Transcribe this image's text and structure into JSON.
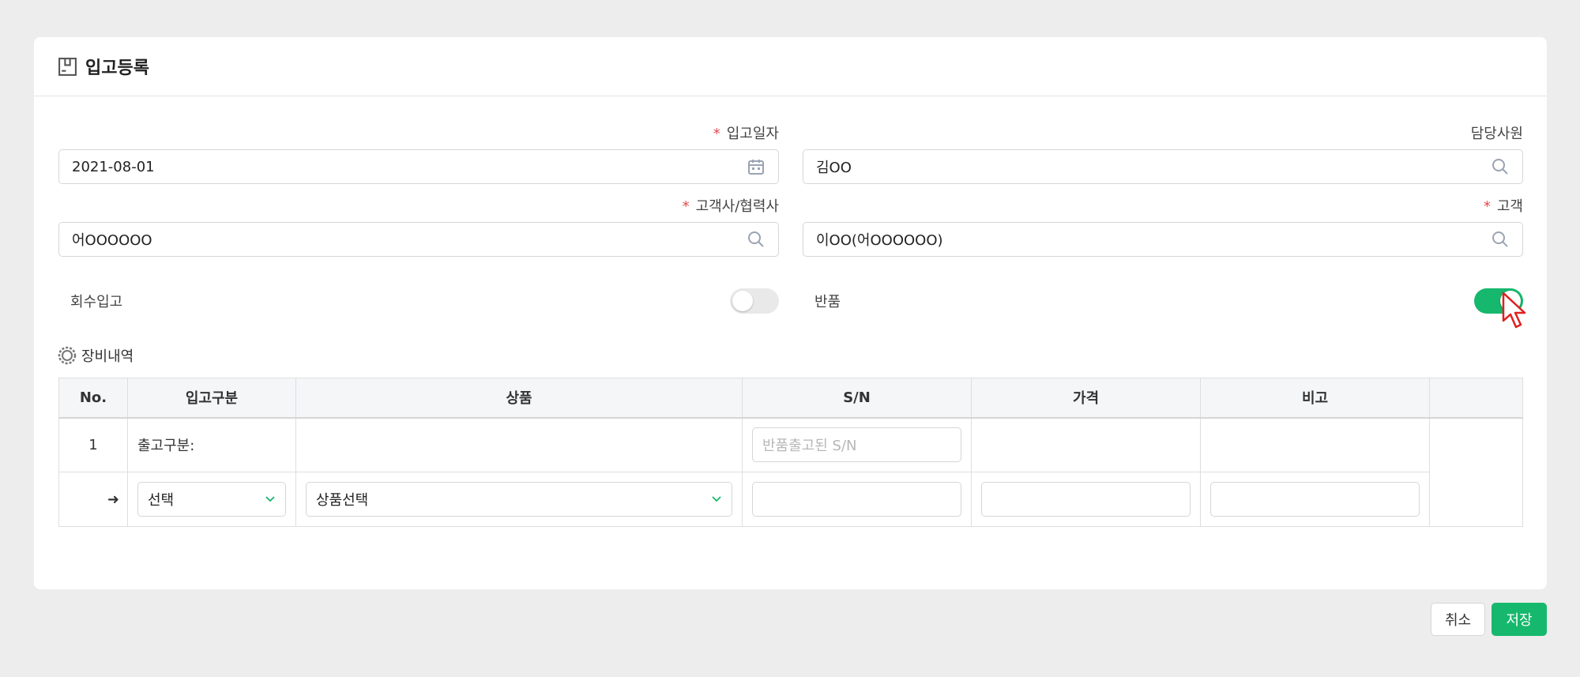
{
  "header": {
    "title": "입고등록",
    "icon": "box-icon"
  },
  "form": {
    "date": {
      "label": "입고일자",
      "required": true,
      "value": "2021-08-01",
      "icon": "calendar-icon"
    },
    "staff": {
      "label": "담당사원",
      "required": false,
      "value": "김OO",
      "icon": "search-icon"
    },
    "partner": {
      "label": "고객사/협력사",
      "required": true,
      "value": "어OOOOOO",
      "icon": "search-icon"
    },
    "customer": {
      "label": "고객",
      "required": true,
      "value": "이OO(어OOOOOO)",
      "icon": "search-icon"
    },
    "required_mark": "*"
  },
  "toggles": {
    "recovery": {
      "label": "회수입고",
      "on": false
    },
    "return": {
      "label": "반품",
      "on": true
    }
  },
  "section": {
    "title": "장비내역",
    "icon": "gear-icon"
  },
  "table": {
    "headers": [
      "No.",
      "입고구분",
      "상품",
      "S/N",
      "가격",
      "비고",
      ""
    ],
    "row1": {
      "no": "1",
      "type_text": "출고구분:",
      "sn_placeholder": "반품출고된 S/N"
    },
    "row2": {
      "type_select": "선택",
      "product_select": "상품선택"
    }
  },
  "buttons": {
    "cancel": "취소",
    "save": "저장"
  },
  "colors": {
    "accent": "#16b86d",
    "required": "#e5484d"
  }
}
